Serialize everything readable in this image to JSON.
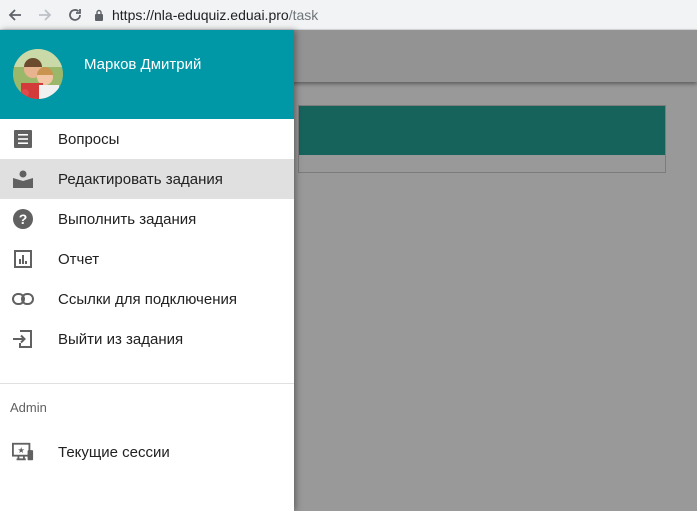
{
  "browser": {
    "url_host": "https://nla-eduquiz.eduai.pro",
    "url_path": "/task"
  },
  "drawer": {
    "user_name": "Марков Дмитрий",
    "menu_items": [
      {
        "label": "Вопросы",
        "icon": "list-icon",
        "active": false
      },
      {
        "label": "Редактировать задания",
        "icon": "book-reader-icon",
        "active": true
      },
      {
        "label": "Выполнить задания",
        "icon": "help-circle-icon",
        "active": false
      },
      {
        "label": "Отчет",
        "icon": "bar-chart-icon",
        "active": false
      },
      {
        "label": "Ссылки для подключения",
        "icon": "link-icon",
        "active": false
      },
      {
        "label": "Выйти из задания",
        "icon": "exit-icon",
        "active": false
      }
    ],
    "admin_header": "Admin",
    "admin_items": [
      {
        "label": "Текущие сессии",
        "icon": "screen-share-icon"
      }
    ]
  },
  "colors": {
    "drawer_header": "#0097a7",
    "card_header": "#26a69a",
    "active_item_bg": "#e0e0e0"
  }
}
